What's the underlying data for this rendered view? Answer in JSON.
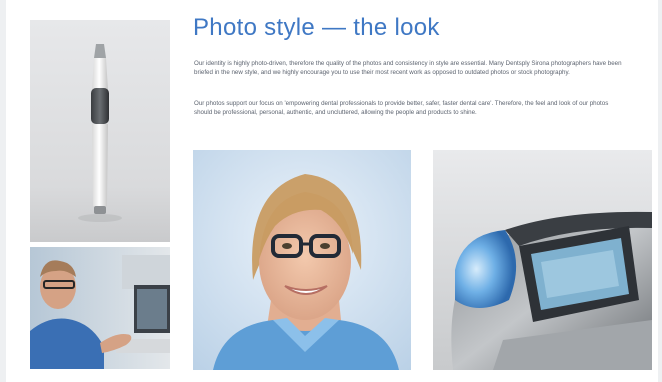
{
  "page": {
    "title": "Photo style — the look",
    "paragraphs": [
      "Our identity is highly photo-driven, therefore the quality of the photos and consistency in style are essential. Many Dentsply Sirona photographers have been briefed in the new style, and we highly encourage you to use their most recent work as opposed to outdated photos or stock photography.",
      "Our photos support our focus on 'empowering dental professionals to provide better, safer, faster dental care'. Therefore, the feel and look of our photos should be professional, personal, authentic, and uncluttered, allowing the people and products to shine."
    ]
  },
  "colors": {
    "title": "#3f78c4",
    "body_text": "#5d6470",
    "background": "#ffffff"
  }
}
